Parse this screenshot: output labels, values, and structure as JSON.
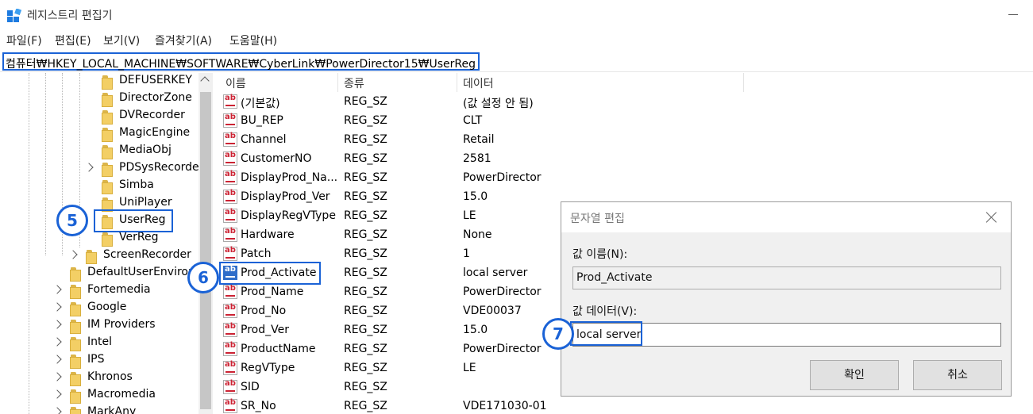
{
  "window": {
    "title": "레지스트리 편집기"
  },
  "menu": [
    "파일(F)",
    "편집(E)",
    "보기(V)",
    "즐겨찾기(A)",
    "도움말(H)"
  ],
  "address": "컴퓨터₩HKEY_LOCAL_MACHINE₩SOFTWARE₩CyberLink₩PowerDirector15₩UserReg",
  "tree": [
    {
      "label": "DEFUSERKEY",
      "expandable": false
    },
    {
      "label": "DirectorZone",
      "expandable": false
    },
    {
      "label": "DVRecorder",
      "expandable": false
    },
    {
      "label": "MagicEngine",
      "expandable": false
    },
    {
      "label": "MediaObj",
      "expandable": false
    },
    {
      "label": "PDSysRecorde",
      "expandable": true
    },
    {
      "label": "Simba",
      "expandable": false
    },
    {
      "label": "UniPlayer",
      "expandable": false
    },
    {
      "label": "UserReg",
      "expandable": false
    },
    {
      "label": "VerReg",
      "expandable": false
    },
    {
      "label": "ScreenRecorder",
      "expandable": true
    },
    {
      "label": "DefaultUserEnvironr",
      "expandable": false
    },
    {
      "label": "Fortemedia",
      "expandable": true
    },
    {
      "label": "Google",
      "expandable": true
    },
    {
      "label": "IM Providers",
      "expandable": true
    },
    {
      "label": "Intel",
      "expandable": true
    },
    {
      "label": "IPS",
      "expandable": true
    },
    {
      "label": "Khronos",
      "expandable": true
    },
    {
      "label": "Macromedia",
      "expandable": true
    },
    {
      "label": "MarkAny",
      "expandable": true
    }
  ],
  "list": {
    "columns": [
      "이름",
      "종류",
      "데이터"
    ],
    "rows": [
      {
        "name": "(기본값)",
        "type": "REG_SZ",
        "data": "(값 설정 안 됨)"
      },
      {
        "name": "BU_REP",
        "type": "REG_SZ",
        "data": "CLT"
      },
      {
        "name": "Channel",
        "type": "REG_SZ",
        "data": "Retail"
      },
      {
        "name": "CustomerNO",
        "type": "REG_SZ",
        "data": "2581"
      },
      {
        "name": "DisplayProd_Na...",
        "type": "REG_SZ",
        "data": "PowerDirector"
      },
      {
        "name": "DisplayProd_Ver",
        "type": "REG_SZ",
        "data": "15.0"
      },
      {
        "name": "DisplayRegVType",
        "type": "REG_SZ",
        "data": "LE"
      },
      {
        "name": "Hardware",
        "type": "REG_SZ",
        "data": "None"
      },
      {
        "name": "Patch",
        "type": "REG_SZ",
        "data": "1"
      },
      {
        "name": "Prod_Activate",
        "type": "REG_SZ",
        "data": "local server"
      },
      {
        "name": "Prod_Name",
        "type": "REG_SZ",
        "data": "PowerDirector"
      },
      {
        "name": "Prod_No",
        "type": "REG_SZ",
        "data": "VDE00037"
      },
      {
        "name": "Prod_Ver",
        "type": "REG_SZ",
        "data": "15.0"
      },
      {
        "name": "ProductName",
        "type": "REG_SZ",
        "data": "PowerDirector"
      },
      {
        "name": "RegVType",
        "type": "REG_SZ",
        "data": "LE"
      },
      {
        "name": "SID",
        "type": "REG_SZ",
        "data": ""
      },
      {
        "name": "SR_No",
        "type": "REG_SZ",
        "data": "VDE171030-01"
      }
    ]
  },
  "dialog": {
    "title": "문자열 편집",
    "name_label": "값 이름(N):",
    "name_value": "Prod_Activate",
    "data_label": "값 데이터(V):",
    "data_value": "local server",
    "ok": "확인",
    "cancel": "취소"
  },
  "markers": [
    "5",
    "6",
    "7"
  ],
  "colors": {
    "accent": "#1a62d6",
    "folder": "#f3cf65"
  }
}
